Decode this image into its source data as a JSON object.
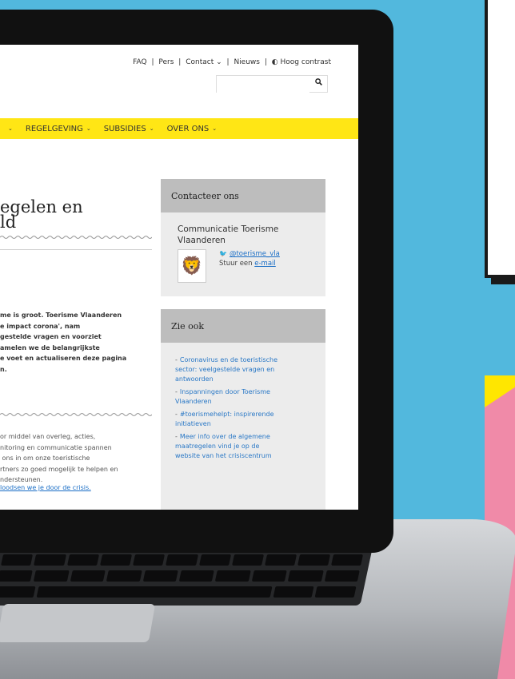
{
  "topbar": {
    "links": [
      "FAQ",
      "Pers",
      "Contact",
      "Nieuws"
    ],
    "contact_has_dropdown": true,
    "high_contrast_label": "Hoog contrast",
    "separator": "|"
  },
  "search": {
    "placeholder": "",
    "value": ""
  },
  "nav": {
    "items": [
      {
        "label": ""
      },
      {
        "label": "REGELGEVING"
      },
      {
        "label": "SUBSIDIES"
      },
      {
        "label": "OVER ONS"
      }
    ],
    "chevron": "⌄"
  },
  "page": {
    "title": "egelen en\nld",
    "intro": "me is groot. Toerisme Vlaanderen\ne impact corona', nam\ngestelde vragen en voorziet\namelen we de belangrijkste\ne voet en actualiseren deze pagina\nn.",
    "body": "or middel van overleg, acties,\nnitoring en communicatie spannen\n ons in om onze toeristische\nrtners zo goed mogelijk te helpen en\nndersteunen.",
    "body_link": "loodsen we je door de crisis."
  },
  "contact": {
    "heading": "Contacteer ons",
    "organization": "Communicatie Toerisme\nVlaanderen",
    "twitter_handle": "@toerisme_vla",
    "mail_prefix": "Stuur een ",
    "mail_link": "e-mail"
  },
  "see_also": {
    "heading": "Zie ook",
    "items": [
      "Coronavirus en de toeristische\nsector: veelgestelde vragen en\nantwoorden",
      "Inspanningen door Toerisme\nVlaanderen",
      "#toerismehelpt: inspirerende\ninitiatieven",
      "Meer info over de algemene\nmaatregelen vind je op de\nwebsite van het crisiscentrum"
    ]
  },
  "colors": {
    "background": "#52b8dd",
    "nav_yellow": "#ffe615",
    "link_blue": "#1a6ec6",
    "sidebar_header": "#bdbdbd",
    "sidebar_body": "#ececec"
  }
}
